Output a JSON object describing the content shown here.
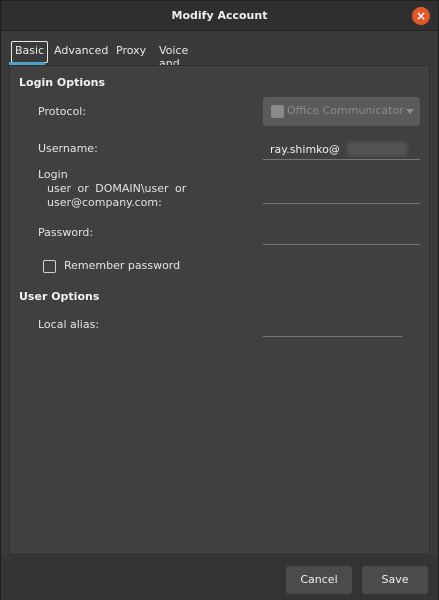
{
  "window": {
    "title": "Modify Account",
    "close_label": "×"
  },
  "tabs": [
    {
      "label": "Basic",
      "active": true
    },
    {
      "label": "Advanced",
      "active": false
    },
    {
      "label": "Proxy",
      "active": false
    },
    {
      "label": "Voice and Video",
      "active": false
    }
  ],
  "login_options": {
    "heading": "Login Options",
    "protocol_label": "Protocol:",
    "protocol_value": "Office Communicator",
    "username_label": "Username:",
    "username_value": "ray.shimko@",
    "login_label_line1": "Login",
    "login_label_line2": "user or DOMAIN\\user or",
    "login_label_line3": "user@company.com:",
    "login_value": "",
    "password_label": "Password:",
    "password_value": "",
    "remember_label": "Remember password",
    "remember_checked": false
  },
  "user_options": {
    "heading": "User Options",
    "alias_label": "Local alias:",
    "alias_value": ""
  },
  "buttons": {
    "cancel": "Cancel",
    "save": "Save"
  },
  "colors": {
    "accent": "#4aa4c8",
    "close": "#e0592b",
    "background": "#3a3a3a"
  }
}
